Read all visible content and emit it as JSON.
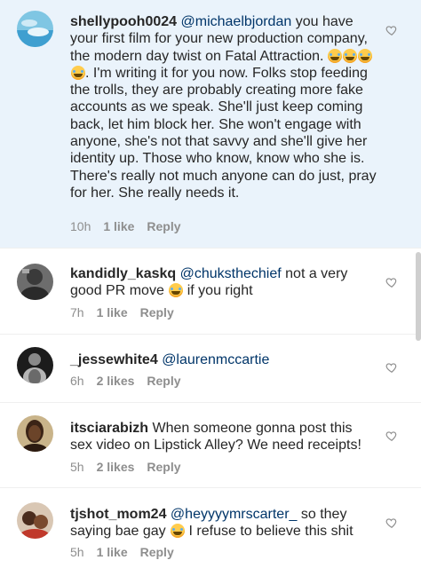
{
  "comments": [
    {
      "username": "shellypooh0024",
      "mention": "@michaelbjordan",
      "text_before_emoji": " you have your first film for your new production company, the modern day twist on Fatal Attraction. ",
      "text_after_emoji": ". I'm writing it for you now. Folks stop feeding the trolls, they are probably creating more fake accounts as we speak. She'll just keep coming back, let him block her. She won't engage with anyone, she's not that savvy and she'll give her identity up. Those who know, know who she is. There's really not much anyone can do just, pray for her. She really needs it.",
      "time": "10h",
      "likes": "1 like",
      "reply": "Reply"
    },
    {
      "username": "kandidly_kaskq",
      "mention": "@chuksthechief",
      "text_before_emoji": " not a very good PR move ",
      "text_after_emoji": " if you right",
      "time": "7h",
      "likes": "1 like",
      "reply": "Reply"
    },
    {
      "username": "_jessewhite4",
      "mention": "@laurenmccartie",
      "time": "6h",
      "likes": "2 likes",
      "reply": "Reply"
    },
    {
      "username": "itsciarabizh",
      "text": "When someone gonna post this sex video on Lipstick Alley? We need receipts!",
      "time": "5h",
      "likes": "2 likes",
      "reply": "Reply"
    },
    {
      "username": "tjshot_mom24",
      "mention": "@heyyyymrscarter_",
      "text_before_emoji": " so they saying bae gay ",
      "text_after_emoji": " I refuse to believe this shit",
      "time": "5h",
      "likes": "1 like",
      "reply": "Reply"
    }
  ],
  "icons": {
    "like": "heart-outline-icon",
    "emoji": "laughing-tears-emoji"
  },
  "colors": {
    "highlight_bg": "#eaf3fb",
    "mention": "#003569",
    "meta": "#8e8e8e"
  }
}
